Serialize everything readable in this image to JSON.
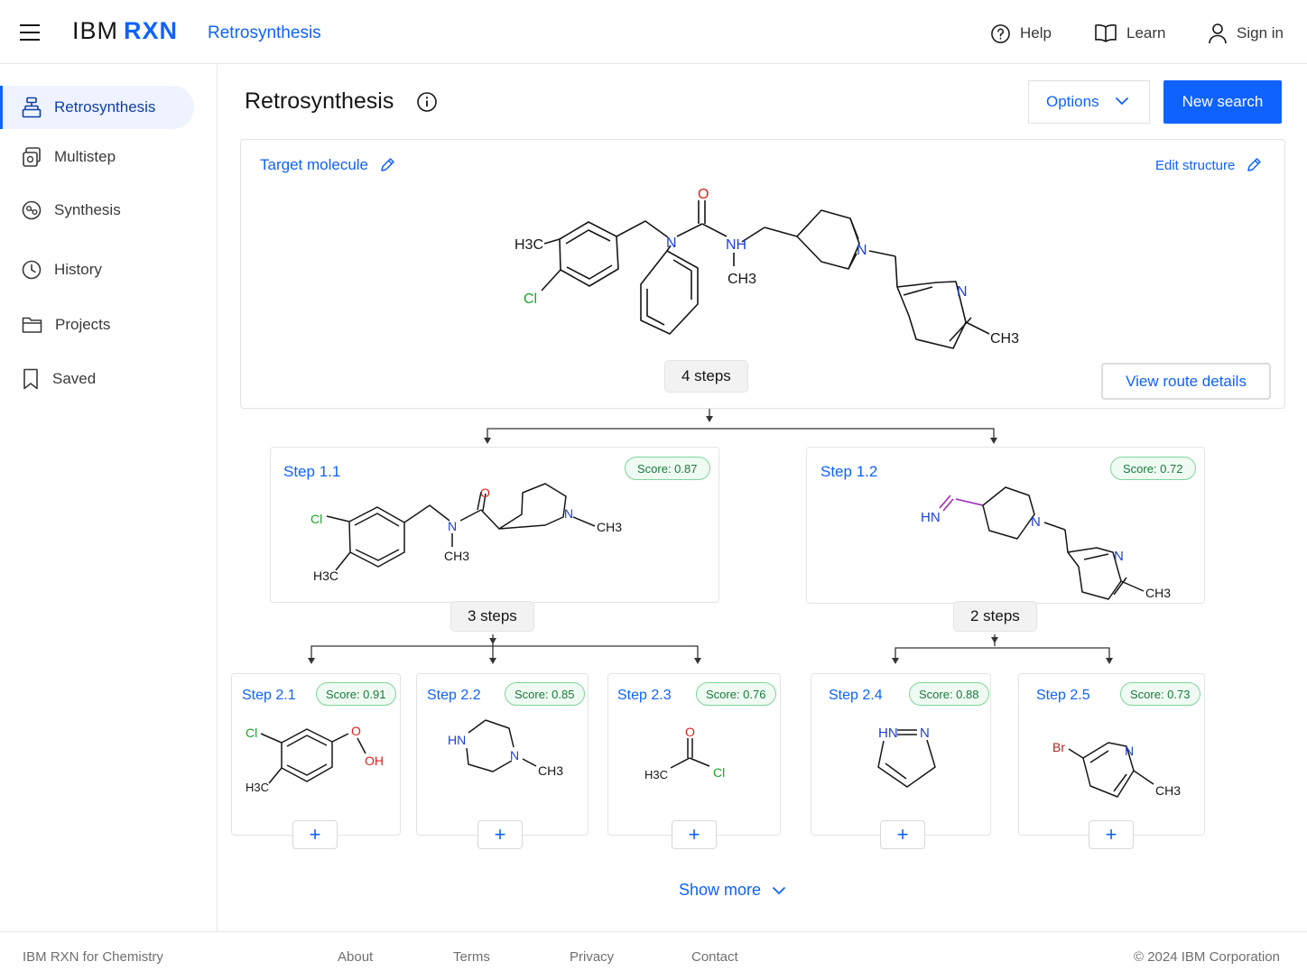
{
  "header": {
    "brand": "IBM",
    "brand_product": "RXN",
    "section": "Retrosynthesis",
    "nav": [
      {
        "label": "Help",
        "icon": "help-icon"
      },
      {
        "label": "Learn",
        "icon": "book-icon"
      },
      {
        "label": "Sign in",
        "icon": "user-icon"
      }
    ]
  },
  "sidebar": {
    "items": [
      {
        "label": "Retrosynthesis",
        "icon": "retrosynthesis-icon",
        "active": true
      },
      {
        "label": "Multistep",
        "icon": "multistep-icon"
      },
      {
        "label": "Synthesis",
        "icon": "synthesis-icon"
      },
      {
        "label": "History",
        "icon": "clock-icon"
      },
      {
        "label": "Projects",
        "icon": "folder-icon"
      },
      {
        "label": "Saved",
        "icon": "bookmark-icon"
      }
    ]
  },
  "main": {
    "title": "Retrosynthesis",
    "options_label": "Options",
    "new_search_label": "New search",
    "target": {
      "label": "Target molecule",
      "edit_structure": "Edit structure",
      "steps": "4 steps",
      "view_route": "View route details",
      "atoms": {
        "methyl_left": "H3C",
        "chloro": "Cl",
        "amide_n": "N",
        "oxygen": "O",
        "methyl_n": "NH",
        "methyl_n_sub": "CH3",
        "pip_n": "N",
        "pyr_n": "N",
        "pyr_methyl": "CH3"
      }
    },
    "level1": [
      {
        "label": "Step 1.1",
        "score": "Score: 0.87",
        "steps": "3 steps",
        "atoms": {
          "chloro": "Cl",
          "methyl": "H3C",
          "amide_n": "N",
          "oxygen": "O",
          "n_methyl": "CH3",
          "pip_n": "N",
          "pip_methyl": "CH3"
        }
      },
      {
        "label": "Step 1.2",
        "score": "Score: 0.72",
        "steps": "2 steps",
        "atoms": {
          "imine": "HN",
          "pip_n": "N",
          "pyr_n": "N",
          "pyr_methyl": "CH3"
        }
      }
    ],
    "level2": [
      {
        "label": "Step 2.1",
        "score": "Score: 0.91",
        "atoms": {
          "chloro": "Cl",
          "methyl": "H3C",
          "oxygen": "O",
          "hydroxyl": "OH"
        }
      },
      {
        "label": "Step 2.2",
        "score": "Score: 0.85",
        "atoms": {
          "nh": "HN",
          "n": "N",
          "methyl": "CH3"
        }
      },
      {
        "label": "Step 2.3",
        "score": "Score: 0.76",
        "atoms": {
          "oxygen": "O",
          "methyl": "H3C",
          "chloro": "Cl"
        }
      },
      {
        "label": "Step 2.4",
        "score": "Score: 0.88",
        "atoms": {
          "nh": "HN",
          "n": "N"
        }
      },
      {
        "label": "Step 2.5",
        "score": "Score: 0.73",
        "atoms": {
          "bromo": "Br",
          "n": "N",
          "methyl": "CH3"
        }
      }
    ],
    "add_symbol": "+",
    "show_more": "Show more"
  },
  "footer": {
    "brand": "IBM RXN for Chemistry",
    "links": [
      "About",
      "Terms",
      "Privacy",
      "Contact"
    ],
    "copyright": "© 2024 IBM Corporation"
  },
  "colors": {
    "accent": "#0f62fe",
    "oxygen": "#e0201b",
    "chlorine": "#1aa32a",
    "nitrogen": "#1c3fd9",
    "bromine": "#a5261c",
    "score_bg": "#effaf2"
  }
}
